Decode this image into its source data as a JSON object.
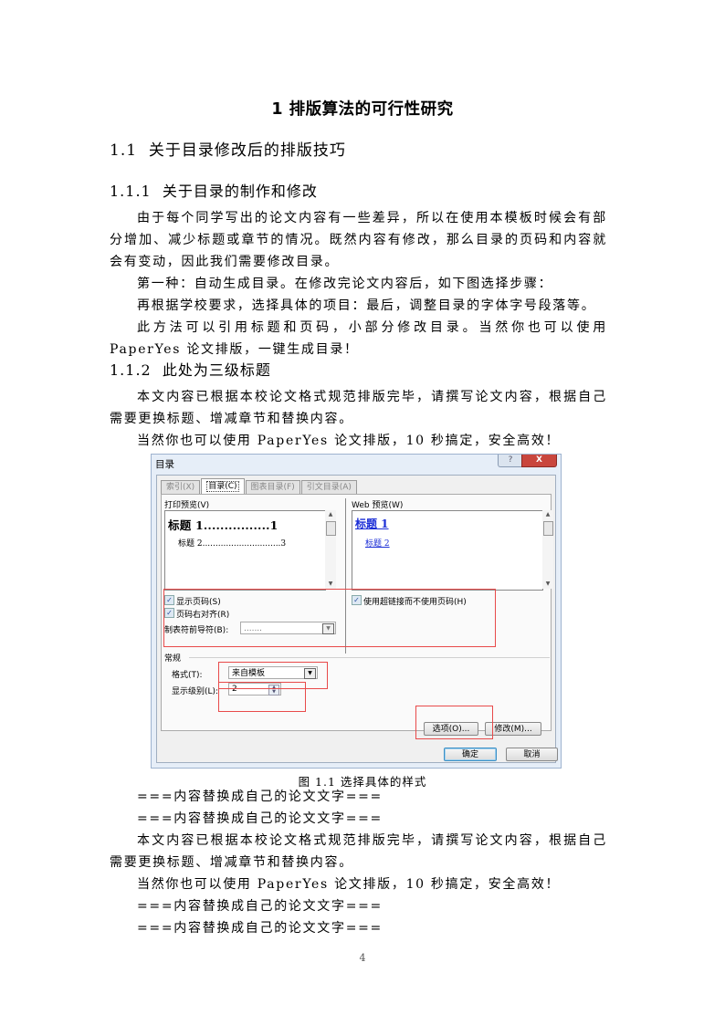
{
  "chapter_title": "1 排版算法的可行性研究",
  "section": {
    "number": "1.1",
    "title": "关于目录修改后的排版技巧"
  },
  "subsection_1": {
    "number": "1.1.1",
    "title": "关于目录的制作和修改"
  },
  "paragraphs_1": [
    "由于每个同学写出的论文内容有一些差异，所以在使用本模板时候会有部分增加、减少标题或章节的情况。既然内容有修改，那么目录的页码和内容就会有变动，因此我们需要修改目录。",
    "第一种：自动生成目录。在修改完论文内容后，如下图选择步骤：",
    "再根据学校要求，选择具体的项目：最后，调整目录的字体字号段落等。",
    "此方法可以引用标题和页码，小部分修改目录。当然你也可以使用 PaperYes 论文排版，一键生成目录！"
  ],
  "subsection_2": {
    "number": "1.1.2",
    "title": "此处为三级标题"
  },
  "paragraphs_2": [
    "本文内容已根据本校论文格式规范排版完毕，请撰写论文内容，根据自己需要更换标题、增减章节和替换内容。",
    "当然你也可以使用 PaperYes 论文排版，10 秒搞定，安全高效！"
  ],
  "dialog": {
    "title": "目录",
    "help_label": "?",
    "close_label": "X",
    "tabs": [
      {
        "label": "索引(X)",
        "active": false
      },
      {
        "label": "目录(C)",
        "active": true
      },
      {
        "label": "图表目录(F)",
        "active": false
      },
      {
        "label": "引文目录(A)",
        "active": false
      }
    ],
    "print_preview": {
      "label": "打印预览(V)",
      "line1": "标题 1................1",
      "line2": "标题 2..............................3"
    },
    "web_preview": {
      "label": "Web 预览(W)",
      "line1": "标题 1",
      "line2": "标题 2"
    },
    "checkboxes": [
      {
        "label": "显示页码(S)",
        "checked": true
      },
      {
        "label": "页码右对齐(R)",
        "checked": true
      },
      {
        "label": "使用超链接而不使用页码(H)",
        "checked": true
      }
    ],
    "tab_leader": {
      "label": "制表符前导符(B):",
      "value": "......."
    },
    "general_label": "常规",
    "format": {
      "label": "格式(T):",
      "value": "来自模板"
    },
    "levels": {
      "label": "显示级别(L):",
      "value": "2"
    },
    "options_button": "选项(O)...",
    "modify_button": "修改(M)...",
    "ok_button": "确定",
    "cancel_button": "取消",
    "highlight_color": "#e84a4a"
  },
  "caption": "图 1.1  选择具体的样式",
  "paragraphs_3": [
    "===内容替换成自己的论文文字===",
    "===内容替换成自己的论文文字===",
    "本文内容已根据本校论文格式规范排版完毕，请撰写论文内容，根据自己需要更换标题、增减章节和替换内容。",
    "当然你也可以使用 PaperYes 论文排版，10 秒搞定，安全高效！",
    "===内容替换成自己的论文文字===",
    "===内容替换成自己的论文文字==="
  ],
  "page_number": "4"
}
